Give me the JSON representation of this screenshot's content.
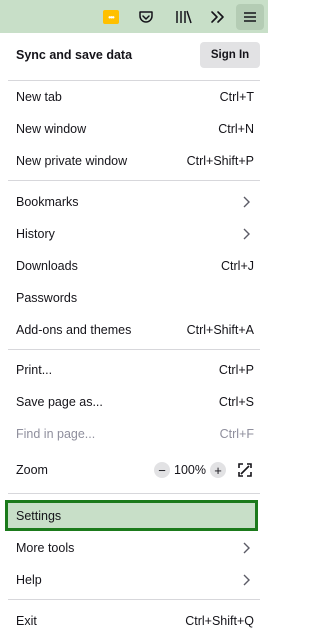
{
  "toolbar": {
    "icons": [
      "extension-icon",
      "pocket-icon",
      "library-icon",
      "overflow-icon",
      "hamburger-menu-icon"
    ],
    "extension_color": "#ffc000",
    "extension_glyph": "•••"
  },
  "menu": {
    "sync": {
      "title": "Sync and save data",
      "button": "Sign In"
    },
    "new_tab": {
      "label": "New tab",
      "shortcut": "Ctrl+T"
    },
    "new_window": {
      "label": "New window",
      "shortcut": "Ctrl+N"
    },
    "new_private": {
      "label": "New private window",
      "shortcut": "Ctrl+Shift+P"
    },
    "bookmarks": {
      "label": "Bookmarks"
    },
    "history": {
      "label": "History"
    },
    "downloads": {
      "label": "Downloads",
      "shortcut": "Ctrl+J"
    },
    "passwords": {
      "label": "Passwords"
    },
    "addons": {
      "label": "Add-ons and themes",
      "shortcut": "Ctrl+Shift+A"
    },
    "print": {
      "label": "Print...",
      "shortcut": "Ctrl+P"
    },
    "save_page": {
      "label": "Save page as...",
      "shortcut": "Ctrl+S"
    },
    "find": {
      "label": "Find in page...",
      "shortcut": "Ctrl+F"
    },
    "zoom": {
      "label": "Zoom",
      "minus": "−",
      "value": "100%",
      "plus": "+"
    },
    "settings": {
      "label": "Settings"
    },
    "more_tools": {
      "label": "More tools"
    },
    "help": {
      "label": "Help"
    },
    "exit": {
      "label": "Exit",
      "shortcut": "Ctrl+Shift+Q"
    }
  },
  "colors": {
    "toolbar_bg": "#c8dfc8",
    "highlight_bg": "#c8dfc8",
    "highlight_border": "#1b7a1b",
    "disabled_text": "#8f8f9d"
  }
}
